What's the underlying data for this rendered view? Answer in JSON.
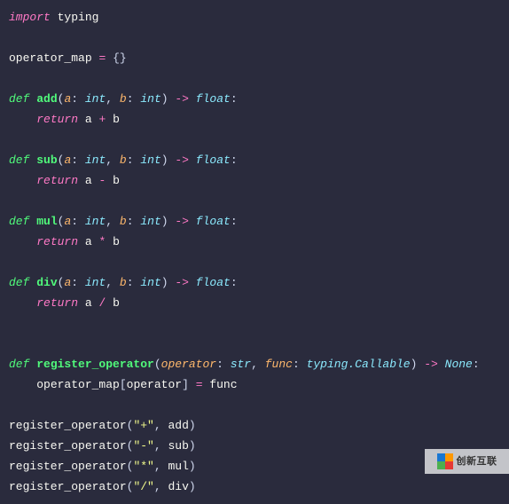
{
  "code": {
    "import_kw": "import",
    "import_mod": "typing",
    "map_decl_name": "operator_map",
    "map_decl_eq": "=",
    "map_decl_val": "{}",
    "def_kw": "def",
    "return_kw": "return",
    "int_type": "int",
    "float_type": "float",
    "str_type": "str",
    "none_type": "None",
    "callable_type": "typing.Callable",
    "arrow": "->",
    "add_fn": "add",
    "sub_fn": "sub",
    "mul_fn": "mul",
    "div_fn": "div",
    "reg_fn": "register_operator",
    "param_a": "a",
    "param_b": "b",
    "param_operator": "operator",
    "param_func": "func",
    "op_plus": "+",
    "op_minus": "-",
    "op_star": "*",
    "op_slash": "/",
    "eq": "=",
    "colon": ":",
    "comma": ",",
    "lparen": "(",
    "rparen": ")",
    "lbrack": "[",
    "rbrack": "]",
    "reg_body_left": "operator_map",
    "reg_body_right": "func",
    "str_plus": "\"+\"",
    "str_minus": "\"-\"",
    "str_star": "\"*\"",
    "str_slash": "\"/\"",
    "call_add": "add",
    "call_sub": "sub",
    "call_mul": "mul",
    "call_div": "div"
  },
  "watermark": {
    "text": "创新互联"
  },
  "chart_data": {
    "type": "table",
    "title": "Python operator registry source code",
    "functions": [
      {
        "name": "add",
        "params": [
          [
            "a",
            "int"
          ],
          [
            "b",
            "int"
          ]
        ],
        "returns": "float",
        "body": "return a + b"
      },
      {
        "name": "sub",
        "params": [
          [
            "a",
            "int"
          ],
          [
            "b",
            "int"
          ]
        ],
        "returns": "float",
        "body": "return a - b"
      },
      {
        "name": "mul",
        "params": [
          [
            "a",
            "int"
          ],
          [
            "b",
            "int"
          ]
        ],
        "returns": "float",
        "body": "return a * b"
      },
      {
        "name": "div",
        "params": [
          [
            "a",
            "int"
          ],
          [
            "b",
            "int"
          ]
        ],
        "returns": "float",
        "body": "return a / b"
      },
      {
        "name": "register_operator",
        "params": [
          [
            "operator",
            "str"
          ],
          [
            "func",
            "typing.Callable"
          ]
        ],
        "returns": "None",
        "body": "operator_map[operator] = func"
      }
    ],
    "calls": [
      [
        "register_operator",
        "\"+\"",
        "add"
      ],
      [
        "register_operator",
        "\"-\"",
        "sub"
      ],
      [
        "register_operator",
        "\"*\"",
        "mul"
      ],
      [
        "register_operator",
        "\"/\"",
        "div"
      ]
    ]
  }
}
